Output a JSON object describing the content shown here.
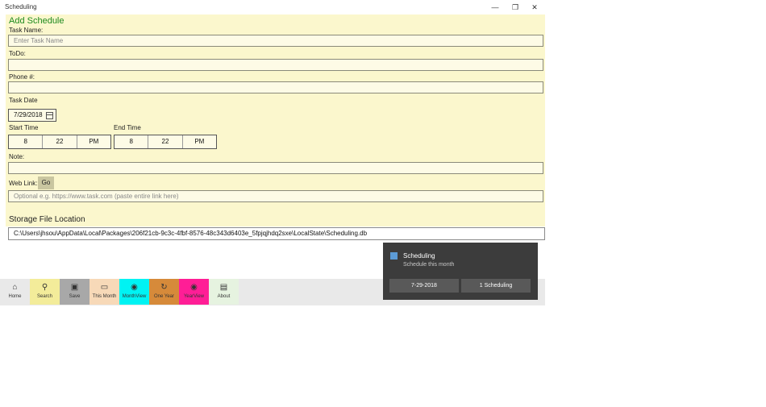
{
  "window": {
    "title": "Scheduling",
    "minimize_glyph": "—",
    "restore_glyph": "❐",
    "close_glyph": "✕"
  },
  "form": {
    "heading": "Add Schedule",
    "task_name_label": "Task Name:",
    "task_name_placeholder": "Enter Task Name",
    "todo_label": "ToDo:",
    "phone_label": "Phone #:",
    "task_date_label": "Task Date",
    "task_date_value": "7/29/2018",
    "start_time_label": "Start Time",
    "start_time": {
      "hour": "8",
      "minute": "22",
      "period": "PM"
    },
    "end_time_label": "End Time",
    "end_time": {
      "hour": "8",
      "minute": "22",
      "period": "PM"
    },
    "note_label": "Note:",
    "web_link_label": "Web Link:",
    "go_label": "Go",
    "web_link_placeholder": "Optional e.g. https://www.task.com (paste entire link here)",
    "storage_title": "Storage File Location",
    "storage_path": "C:\\Users\\jhsou\\AppData\\Local\\Packages\\206f21cb-9c3c-4fbf-8576-48c343d6403e_5fpjqjhdq2sxe\\LocalState\\Scheduling.db"
  },
  "appbar": {
    "items": [
      {
        "label": "Home",
        "icon": "home-icon",
        "color": "#e9e9e9"
      },
      {
        "label": "Search",
        "icon": "search-icon",
        "color": "#f3ec9a"
      },
      {
        "label": "Save",
        "icon": "save-icon",
        "color": "#a8a8a8"
      },
      {
        "label": "This Month",
        "icon": "camera-icon",
        "color": "#f7d9b8"
      },
      {
        "label": "MonthView",
        "icon": "eye-icon",
        "color": "#00f3f3"
      },
      {
        "label": "One Year",
        "icon": "refresh-icon",
        "color": "#d68a3a"
      },
      {
        "label": "YearView",
        "icon": "eye-icon",
        "color": "#ff1e96"
      },
      {
        "label": "About",
        "icon": "chat-icon",
        "color": "#e6f3e0"
      }
    ]
  },
  "toast": {
    "title": "Scheduling",
    "body": "Schedule this month",
    "button1": "7-29-2018",
    "button2": "1 Scheduling"
  }
}
